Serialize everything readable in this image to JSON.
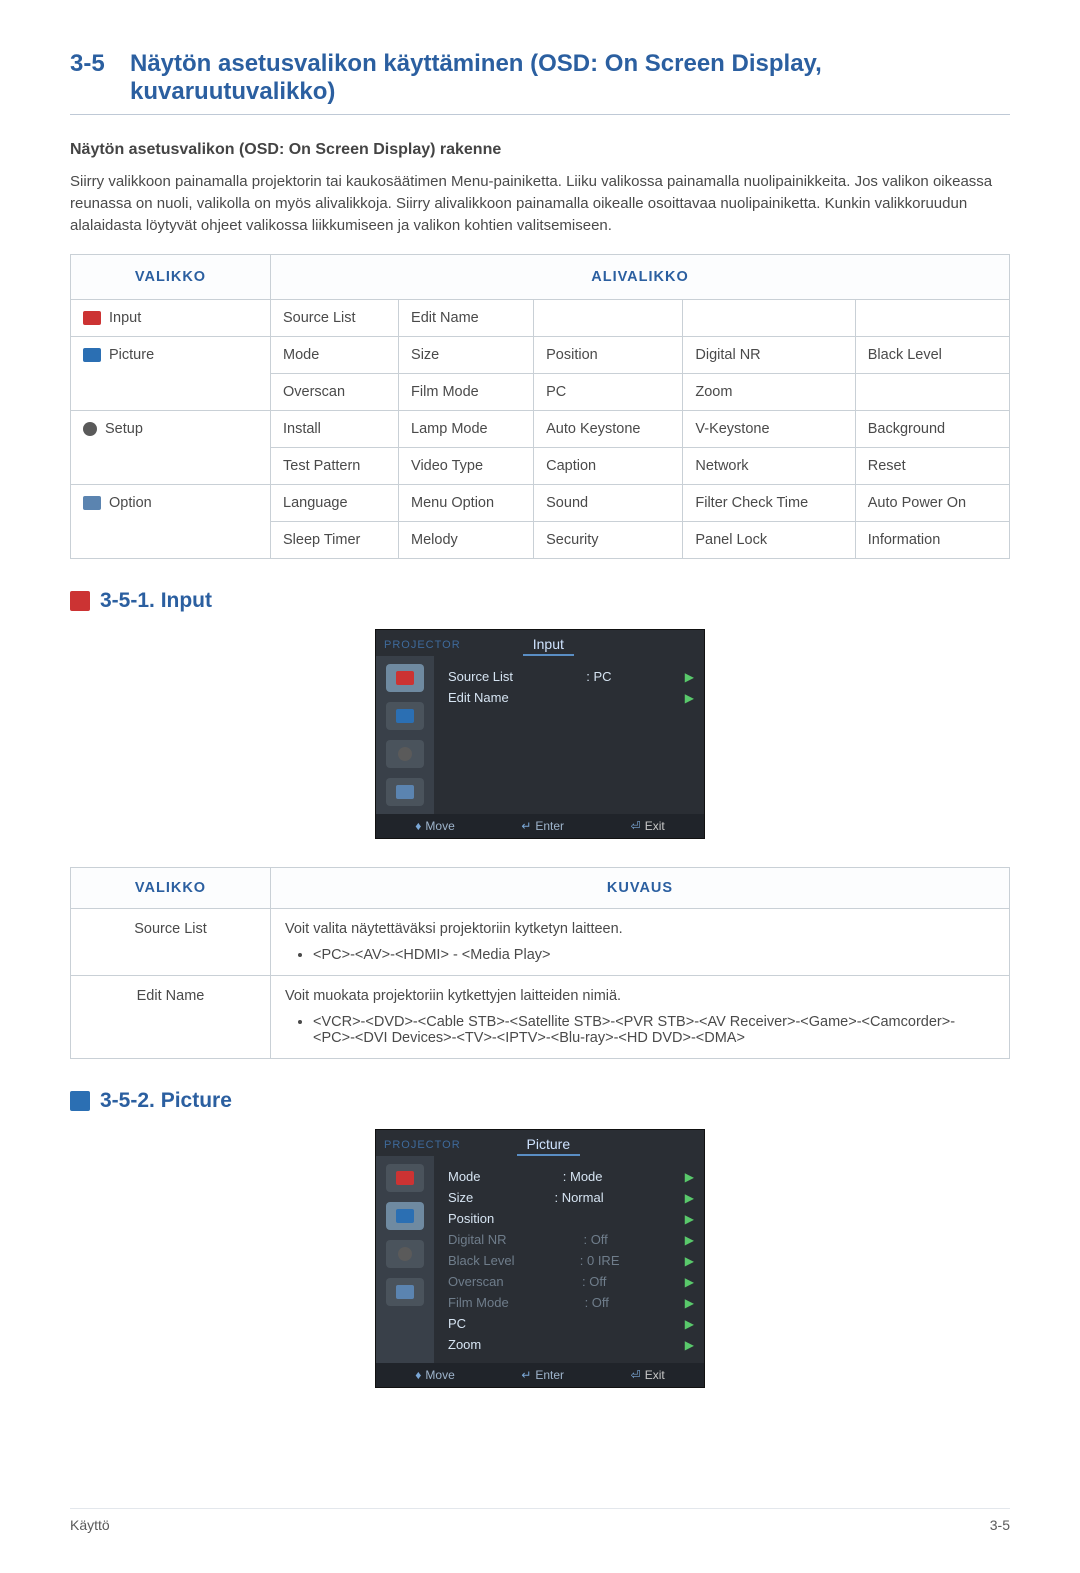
{
  "heading": {
    "num": "3-5",
    "title": "Näytön asetusvalikon käyttäminen (OSD: On Screen Display, kuvaruutuvalikko)"
  },
  "subhead": "Näytön asetusvalikon (OSD: On Screen Display) rakenne",
  "intro": "Siirry valikkoon painamalla projektorin tai kaukosäätimen Menu-painiketta. Liiku valikossa painamalla nuolipainikkeita. Jos valikon oikeassa reunassa on nuoli, valikolla on myös alivalikkoja. Siirry alivalikkoon painamalla oikealle osoittavaa nuolipainiketta. Kunkin valikkoruudun alalaidasta löytyvät ohjeet valikossa liikkumiseen ja valikon kohtien valitsemiseen.",
  "t1": {
    "h_menu": "VALIKKO",
    "h_sub": "ALIVALIKKO",
    "rows": {
      "input": {
        "label": "Input",
        "r1": [
          "Source List",
          "Edit Name",
          "",
          "",
          ""
        ]
      },
      "picture": {
        "label": "Picture",
        "r1": [
          "Mode",
          "Size",
          "Position",
          "Digital NR",
          "Black Level"
        ],
        "r2": [
          "Overscan",
          "Film Mode",
          "PC",
          "Zoom",
          ""
        ]
      },
      "setup": {
        "label": "Setup",
        "r1": [
          "Install",
          "Lamp Mode",
          "Auto Keystone",
          "V-Keystone",
          "Background"
        ],
        "r2": [
          "Test Pattern",
          "Video Type",
          "Caption",
          "Network",
          "Reset"
        ]
      },
      "option": {
        "label": "Option",
        "r1": [
          "Language",
          "Menu Option",
          "Sound",
          "Filter Check Time",
          "Auto Power On"
        ],
        "r2": [
          "Sleep Timer",
          "Melody",
          "Security",
          "Panel Lock",
          "Information"
        ]
      }
    }
  },
  "s351": {
    "title": "3-5-1. Input",
    "osd": {
      "brand": "PROJECTOR",
      "tab": "Input",
      "items": [
        {
          "label": "Source List",
          "value": ": PC"
        },
        {
          "label": "Edit Name",
          "value": ""
        }
      ],
      "footer": {
        "move": "Move",
        "enter": "Enter",
        "exit": "Exit"
      }
    }
  },
  "t2": {
    "h_menu": "VALIKKO",
    "h_desc": "KUVAUS",
    "rows": {
      "sourcelist": {
        "menu": "Source List",
        "p": "Voit valita näytettäväksi projektoriin kytketyn laitteen.",
        "li": "<PC>-<AV>-<HDMI> - <Media Play>"
      },
      "editname": {
        "menu": "Edit Name",
        "p": "Voit muokata projektoriin kytkettyjen laitteiden nimiä.",
        "li": "<VCR>-<DVD>-<Cable STB>-<Satellite STB>-<PVR STB>-<AV Receiver>-<Game>-<Camcorder>-<PC>-<DVI Devices>-<TV>-<IPTV>-<Blu-ray>-<HD DVD>-<DMA>"
      }
    }
  },
  "s352": {
    "title": "3-5-2. Picture",
    "osd": {
      "brand": "PROJECTOR",
      "tab": "Picture",
      "rows": [
        {
          "label": "Mode",
          "value": ": Mode",
          "dim": false
        },
        {
          "label": "Size",
          "value": ": Normal",
          "dim": false
        },
        {
          "label": "Position",
          "value": "",
          "dim": false
        },
        {
          "label": "Digital NR",
          "value": ": Off",
          "dim": true
        },
        {
          "label": "Black Level",
          "value": ": 0 IRE",
          "dim": true
        },
        {
          "label": "Overscan",
          "value": ": Off",
          "dim": true
        },
        {
          "label": "Film Mode",
          "value": ": Off",
          "dim": true
        },
        {
          "label": "PC",
          "value": "",
          "dim": false
        },
        {
          "label": "Zoom",
          "value": "",
          "dim": false
        }
      ],
      "footer": {
        "move": "Move",
        "enter": "Enter",
        "exit": "Exit"
      }
    }
  },
  "footer": {
    "left": "Käyttö",
    "right": "3-5"
  }
}
